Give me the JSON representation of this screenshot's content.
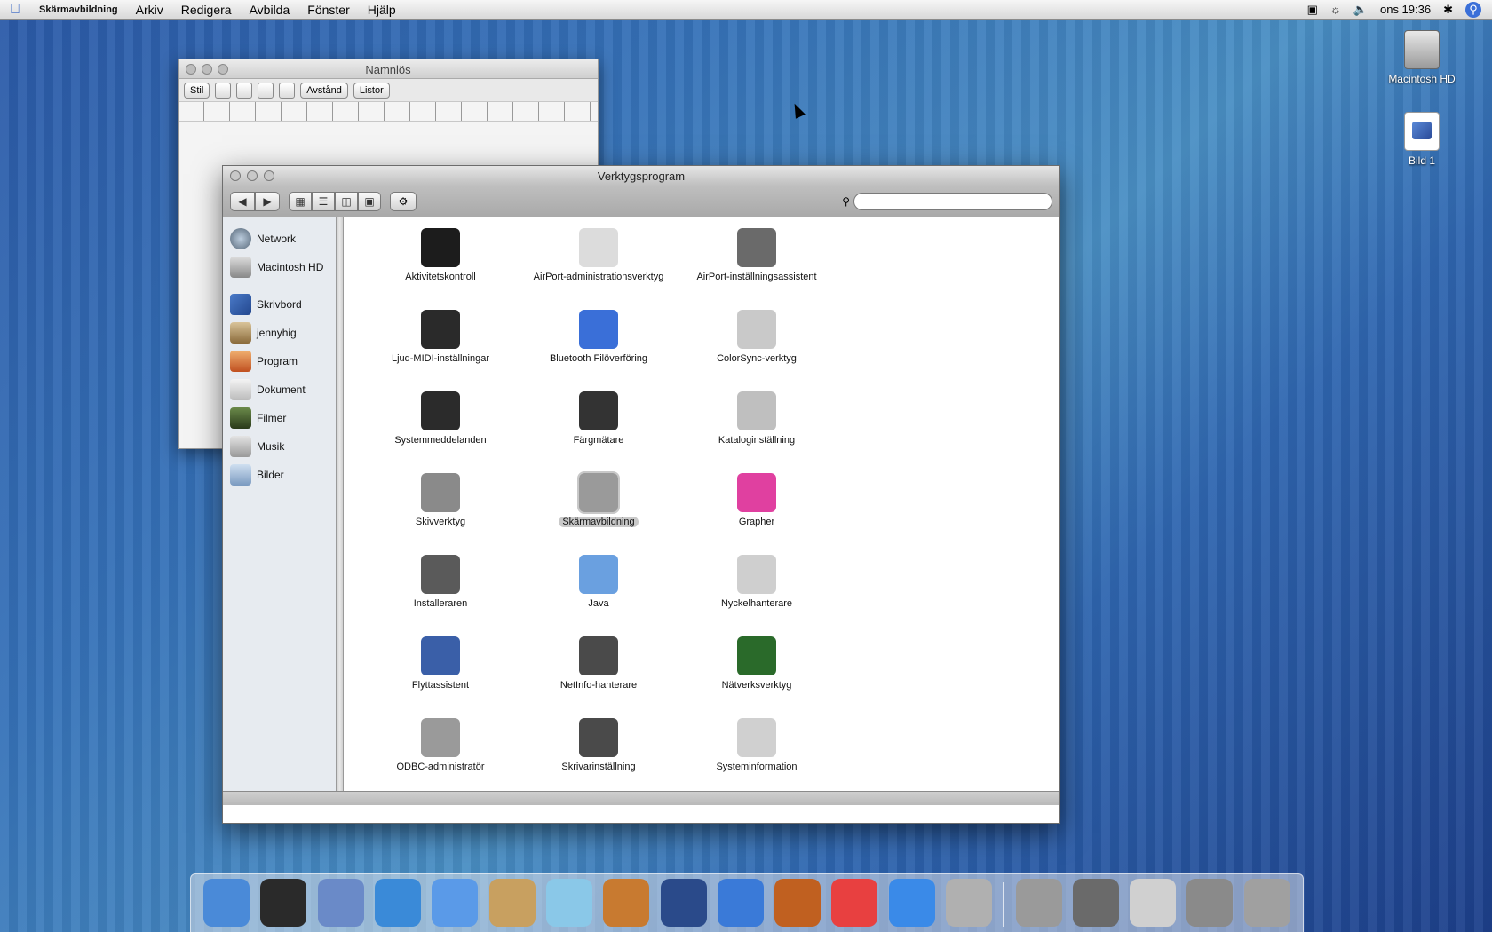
{
  "menubar": {
    "app_name": "Skärmavbildning",
    "items": [
      "Arkiv",
      "Redigera",
      "Avbilda",
      "Fönster",
      "Hjälp"
    ],
    "clock": "ons 19:36"
  },
  "desktop": {
    "icons": [
      {
        "label": "Macintosh HD"
      },
      {
        "label": "Bild 1"
      }
    ]
  },
  "bg_window": {
    "title": "Namnlös",
    "style_label": "Stil",
    "spacing_label": "Avstånd",
    "lists_label": "Listor"
  },
  "finder": {
    "title": "Verktygsprogram",
    "search_placeholder": "",
    "sidebar": [
      "Network",
      "Macintosh HD",
      "Skrivbord",
      "jennyhig",
      "Program",
      "Dokument",
      "Filmer",
      "Musik",
      "Bilder"
    ],
    "apps": [
      {
        "label": "Aktivitetskontroll",
        "icon": "monitor-icon",
        "color": "#1c1c1c"
      },
      {
        "label": "AirPort-administrationsverktyg",
        "icon": "airport-icon",
        "color": "#dcdcdc"
      },
      {
        "label": "AirPort-inställningsassistent",
        "icon": "airport-setup-icon",
        "color": "#6a6a6a"
      },
      {
        "label": "Ljud-MIDI-inställningar",
        "icon": "midi-icon",
        "color": "#2a2a2a"
      },
      {
        "label": "Bluetooth Filöverföring",
        "icon": "bluetooth-icon",
        "color": "#3a6fd8"
      },
      {
        "label": "ColorSync-verktyg",
        "icon": "colorsync-icon",
        "color": "#c9c9c9"
      },
      {
        "label": "Systemmeddelanden",
        "icon": "console-icon",
        "color": "#2b2b2b"
      },
      {
        "label": "Färgmätare",
        "icon": "colormeter-icon",
        "color": "#333333"
      },
      {
        "label": "Kataloginställning",
        "icon": "directory-icon",
        "color": "#bfbfbf"
      },
      {
        "label": "Skivverktyg",
        "icon": "disk-utility-icon",
        "color": "#8a8a8a"
      },
      {
        "label": "Skärmavbildning",
        "icon": "grab-icon",
        "color": "#9a9a9a"
      },
      {
        "label": "Grapher",
        "icon": "grapher-icon",
        "color": "#e040a0"
      },
      {
        "label": "Installeraren",
        "icon": "installer-icon",
        "color": "#5a5a5a"
      },
      {
        "label": "Java",
        "icon": "java-icon",
        "color": "#6aa0e0"
      },
      {
        "label": "Nyckelhanterare",
        "icon": "keychain-icon",
        "color": "#cfcfcf"
      },
      {
        "label": "Flyttassistent",
        "icon": "migration-icon",
        "color": "#3a5fa8"
      },
      {
        "label": "NetInfo-hanterare",
        "icon": "netinfo-icon",
        "color": "#4a4a4a"
      },
      {
        "label": "Nätverksverktyg",
        "icon": "network-utility-icon",
        "color": "#2a6a2a"
      },
      {
        "label": "ODBC-administratör",
        "icon": "odbc-icon",
        "color": "#9a9a9a"
      },
      {
        "label": "Skrivarinställning",
        "icon": "printer-icon",
        "color": "#4a4a4a"
      },
      {
        "label": "Systeminformation",
        "icon": "system-profiler-icon",
        "color": "#d0d0d0"
      }
    ]
  },
  "dock": {
    "items": [
      "finder-icon",
      "dashboard-icon",
      "mail-icon",
      "safari-icon",
      "ichat-icon",
      "address-book-icon",
      "itunes-icon",
      "iphoto-icon",
      "imovie-icon",
      "iweb-icon",
      "garageband-icon",
      "ical-icon",
      "quicktime-icon",
      "preferences-icon",
      "grab-icon",
      "stack-icon",
      "document-icon",
      "network-icon",
      "trash-icon"
    ]
  }
}
